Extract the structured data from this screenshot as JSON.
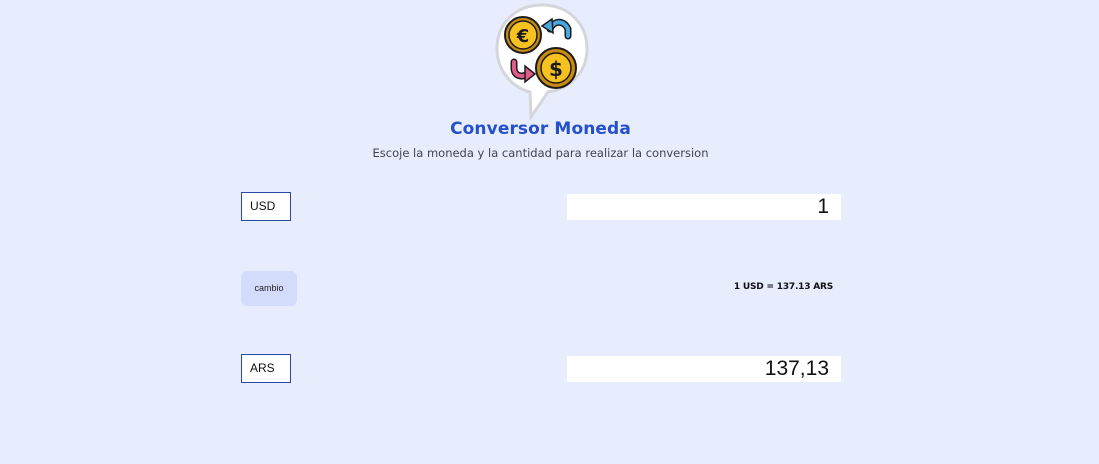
{
  "header": {
    "title": "Conversor Moneda",
    "subtitle": "Escoje la moneda y la cantidad para realizar la conversion",
    "logo": {
      "icons": [
        "euro-coin-icon",
        "dollar-coin-icon",
        "arrow-icon"
      ]
    }
  },
  "converter": {
    "from": {
      "currency": "USD",
      "amount": "1"
    },
    "swap_label": "cambio",
    "rate_text": "1 USD = 137.13 ARS",
    "to": {
      "currency": "ARS",
      "amount": "137,13"
    }
  },
  "colors": {
    "background": "#e8edfe",
    "title": "#2450c9",
    "button": "#d3dcfa",
    "select_border": "#2b4aa8"
  }
}
